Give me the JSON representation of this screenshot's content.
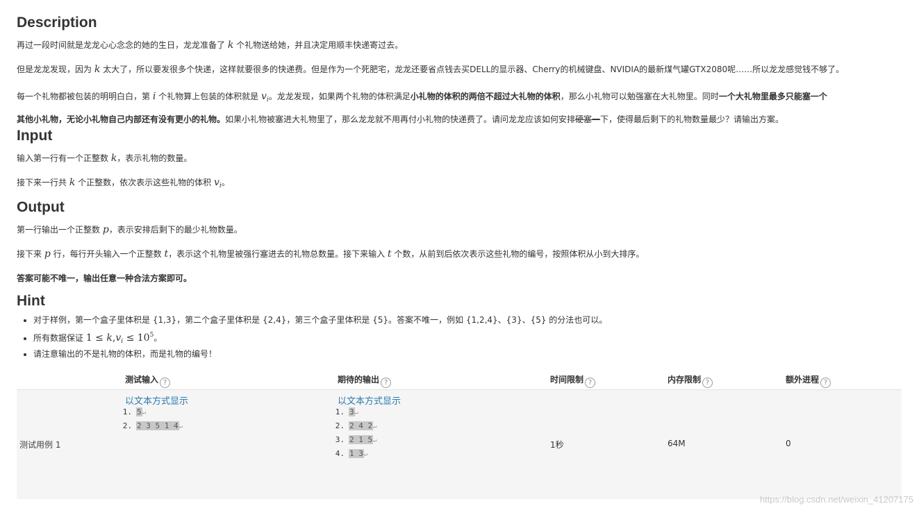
{
  "description": {
    "heading": "Description",
    "p1": {
      "a": "再过一段时间就是龙龙心心念念的她的生日，龙龙准备了 ",
      "m1": "k",
      "b": " 个礼物送给她，并且决定用顺丰快递寄过去。"
    },
    "p2": {
      "a": "但是龙龙发现，因为 ",
      "m1": "k",
      "b": " 太大了，所以要发很多个快递，这样就要很多的快递费。但是作为一个死肥宅，龙龙还要省点钱去买DELL的显示器、Cherry的机械键盘、NVIDIA的最新煤气罐GTX2080呢……所以龙龙感觉钱不够了。"
    },
    "p3": {
      "a": "每一个礼物都被包装的明明白白，第 ",
      "m1": "i",
      "b": " 个礼物算上包装的体积就是 ",
      "m2": "v",
      "m2sub": "i",
      "c": "。龙龙发现，如果两个礼物的体积满足",
      "bold1": "小礼物的体积的两倍不超过大礼物的体积",
      "d": "，那么小礼物可以勉强塞在大礼物里。同时",
      "bold2a": "一个大礼物里最多只能塞一个",
      "bold2b": "其他小礼物，无论小礼物自己内部还有没有更小的礼物。",
      "e": "如果小礼物被塞进大礼物里了，那么龙龙就不用再付小礼物的快递费了。请问龙龙应该如何安排",
      "strike": "硬塞一",
      "f": "下，使得最后剩下的礼物数量最少？请输出方案。"
    }
  },
  "input": {
    "heading": "Input",
    "p1": {
      "a": "输入第一行有一个正整数 ",
      "m1": "k",
      "b": "，表示礼物的数量。"
    },
    "p2": {
      "a": "接下来一行共 ",
      "m1": "k",
      "b": " 个正整数，依次表示这些礼物的体积 ",
      "m2": "v",
      "m2sub": "i",
      "c": "。"
    }
  },
  "output": {
    "heading": "Output",
    "p1": {
      "a": "第一行输出一个正整数 ",
      "m1": "p",
      "b": "，表示安排后剩下的最少礼物数量。"
    },
    "p2": {
      "a": "接下来 ",
      "m1": "p",
      "b": " 行，每行开头输入一个正整数 ",
      "m2": "t",
      "c": "，表示这个礼物里被强行塞进去的礼物总数量。接下来输入 ",
      "m3": "t",
      "d": " 个数，从前到后依次表示这些礼物的编号，按照体积从小到大排序。"
    },
    "p3": "答案可能不唯一，输出任意一种合法方案即可。"
  },
  "hint": {
    "heading": "Hint",
    "items": [
      "对于样例，第一个盒子里体积是 {1,3}，第二个盒子里体积是 {2,4}，第三个盒子里体积是 {5}。答案不唯一，例如 {1,2,4}、{3}、{5} 的分法也可以。",
      {
        "a": "所有数据保证 ",
        "m1": "1 ≤ ",
        "m2": "k",
        "m3": ",",
        "m4": "v",
        "m4sub": "i",
        "m5": " ≤ 10",
        "m5sup": "5",
        "b": "。"
      },
      "请注意输出的不是礼物的体积，而是礼物的编号！"
    ]
  },
  "table": {
    "headers": [
      "测试输入",
      "期待的输出",
      "时间限制",
      "内存限制",
      "额外进程"
    ],
    "help_icon": "question-circle-icon",
    "help_glyph": "?",
    "row": {
      "name": "测试用例 1",
      "show_text_link": "以文本方式显示",
      "input_lines": [
        {
          "num": "1.",
          "text": "5"
        },
        {
          "num": "2.",
          "text": "2 3 5 1 4"
        }
      ],
      "output_lines": [
        {
          "num": "1.",
          "text": "3"
        },
        {
          "num": "2.",
          "text": "2 4 2"
        },
        {
          "num": "3.",
          "text": "2 1 5"
        },
        {
          "num": "4.",
          "text": "1 3"
        }
      ],
      "return_glyph": "↵",
      "time_limit": "1秒",
      "memory_limit": "64M",
      "extra_process": "0"
    }
  },
  "watermark": "https://blog.csdn.net/weixin_41207175"
}
